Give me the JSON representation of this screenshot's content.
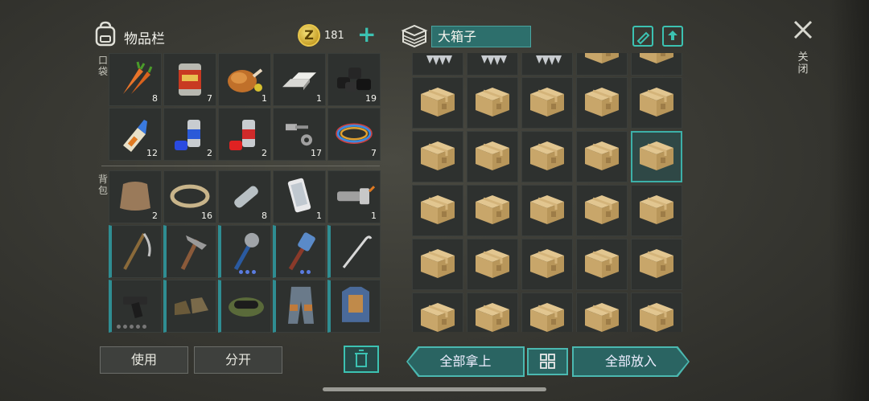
{
  "header": {
    "inventory_title": "物品栏",
    "coin_symbol": "Z",
    "coin_count": "181",
    "plus_symbol": "+"
  },
  "sections": {
    "pockets_label": "口袋",
    "backpack_label": "背包"
  },
  "pocket_items": [
    {
      "name": "carrots-icon",
      "count": "8"
    },
    {
      "name": "canned-food-icon",
      "count": "7"
    },
    {
      "name": "roast-chicken-icon",
      "count": "1"
    },
    {
      "name": "iron-bars-icon",
      "count": "1"
    },
    {
      "name": "coal-icon",
      "count": "19"
    },
    {
      "name": "glue-icon",
      "count": "12"
    },
    {
      "name": "blue-spray-paint-icon",
      "count": "2"
    },
    {
      "name": "red-spray-paint-icon",
      "count": "2"
    },
    {
      "name": "bolts-icon",
      "count": "17"
    },
    {
      "name": "wires-icon",
      "count": "7"
    }
  ],
  "backpack_items": [
    {
      "name": "leather-icon",
      "count": "2"
    },
    {
      "name": "rope-icon",
      "count": "16"
    },
    {
      "name": "plastic-bottle-icon",
      "count": "8"
    },
    {
      "name": "smartphone-icon",
      "count": "1"
    },
    {
      "name": "flashlight-icon",
      "count": "1"
    },
    {
      "name": "scythe-icon",
      "count": ""
    },
    {
      "name": "pickaxe-icon",
      "count": ""
    },
    {
      "name": "saw-blade-mace-icon",
      "count": ""
    },
    {
      "name": "hammer-icon",
      "count": ""
    },
    {
      "name": "crowbar-icon",
      "count": ""
    },
    {
      "name": "pistol-icon",
      "count": ""
    },
    {
      "name": "boots-icon",
      "count": ""
    },
    {
      "name": "goggles-cap-icon",
      "count": ""
    },
    {
      "name": "armored-pants-icon",
      "count": ""
    },
    {
      "name": "armored-vest-icon",
      "count": ""
    }
  ],
  "chest": {
    "name": "大箱子",
    "item_name": "cardboard-box-icon",
    "selected_slot": "row 2 column 5"
  },
  "close": {
    "label": "关闭"
  },
  "buttons": {
    "use": "使用",
    "split": "分开",
    "take_all": "全部拿上",
    "put_all": "全部放入"
  },
  "colors": {
    "accent": "#3cc2b2",
    "teal_dark": "#2a6462",
    "cell_bg": "#2e312f"
  }
}
